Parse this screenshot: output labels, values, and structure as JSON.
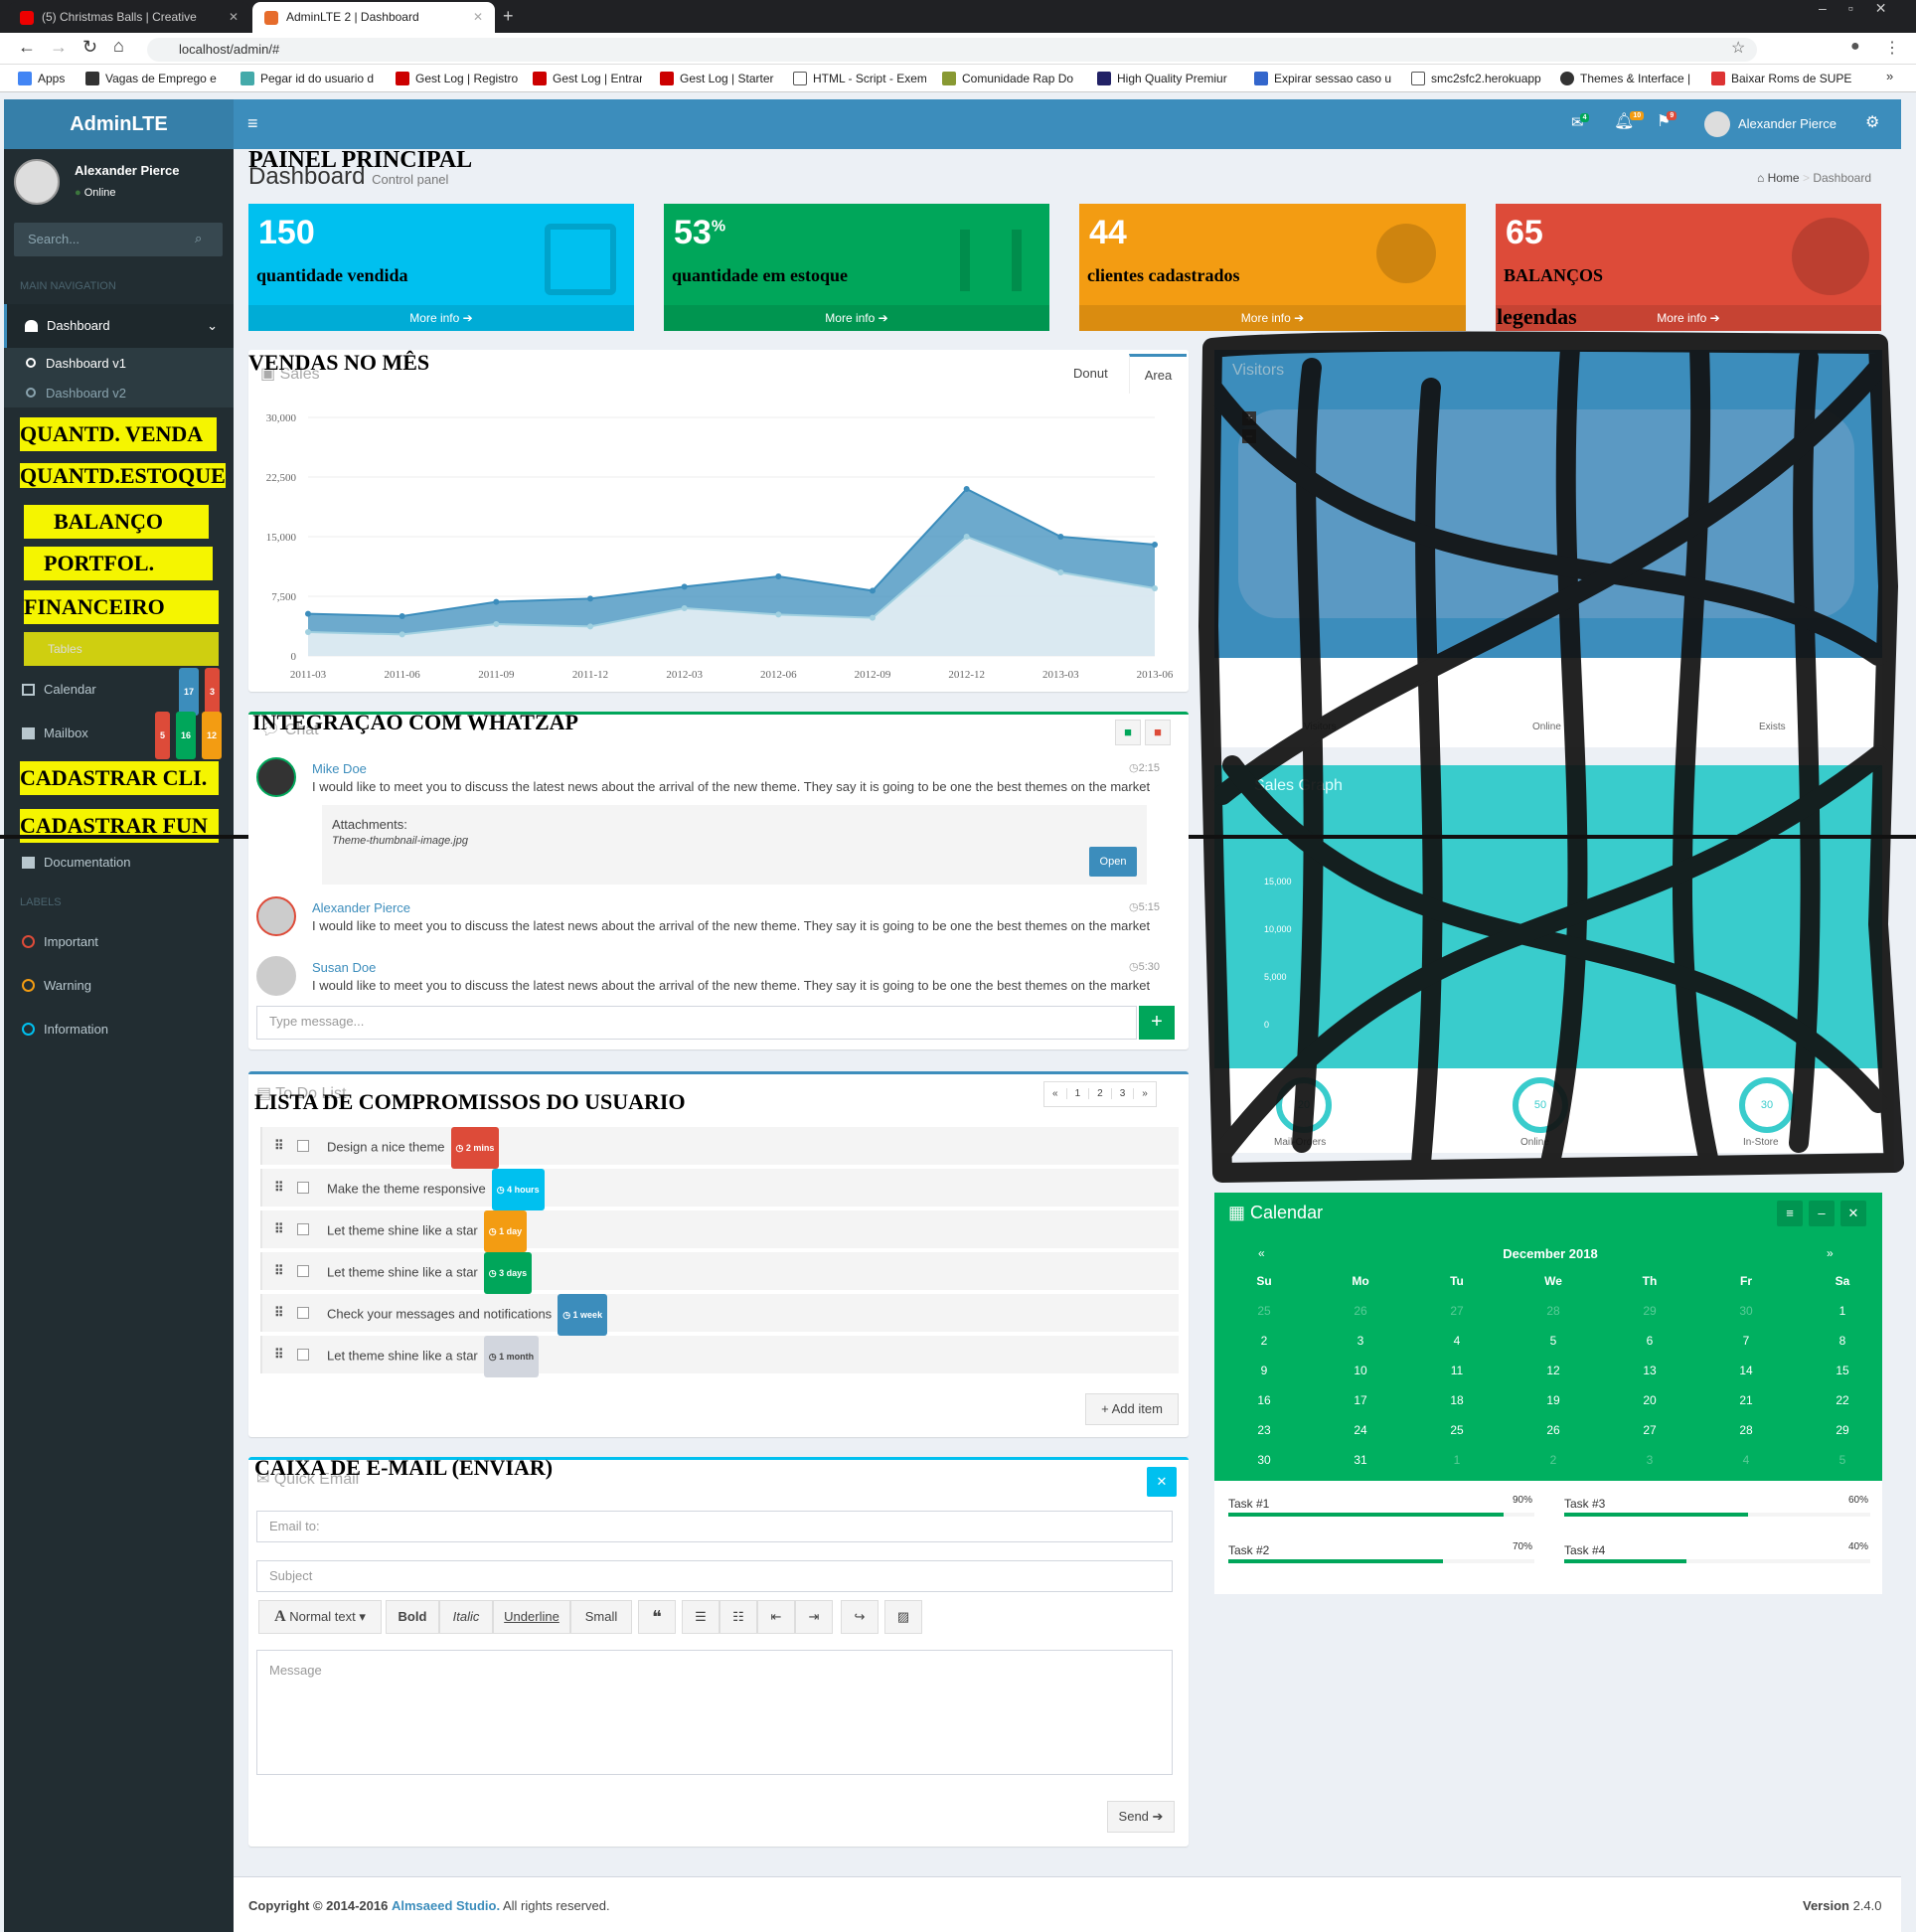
{
  "browser": {
    "tabs": [
      {
        "title": "(5) Christmas Balls | Creative"
      },
      {
        "title": "AdminLTE 2 | Dashboard"
      }
    ],
    "url": "localhost/admin/#",
    "bookmarks": [
      "Apps",
      "Vagas de Emprego e",
      "Pegar id do usuario d",
      "Gest Log | Registro",
      "Gest Log | Entrar",
      "Gest Log | Starter",
      "HTML - Script - Exem",
      "Comunidade Rap Do",
      "High Quality Premiur",
      "Expirar sessao caso u",
      "smc2sfc2.herokuapp",
      "Themes & Interface |",
      "Baixar Roms de SUPE"
    ]
  },
  "app": {
    "logo": "AdminLTE",
    "user": "Alexander Pierce",
    "status": "Online",
    "search_placeholder": "Search..."
  },
  "navbar": {
    "notif_mail": "4",
    "notif_bell": "10",
    "notif_flag": "9"
  },
  "sidebar": {
    "main_nav": "MAIN NAVIGATION",
    "dashboard": "Dashboard",
    "dash_v1": "Dashboard v1",
    "dash_v2": "Dashboard v2",
    "tables": "Tables",
    "calendar": "Calendar",
    "cal_badges": [
      "17",
      "3"
    ],
    "mailbox": "Mailbox",
    "mail_badges": [
      "5",
      "16",
      "12"
    ],
    "documentation": "Documentation",
    "labels_header": "LABELS",
    "labels": [
      "Important",
      "Warning",
      "Information"
    ]
  },
  "annotations": {
    "painel": "PAINEL PRINCIPAL",
    "sidebar": [
      "QUANTD. VENDA",
      "QUANTD.ESTOQUE",
      "BALANÇO",
      "PORTFOL.",
      "FINANCEIRO",
      "CADASTRAR CLI.",
      "CADASTRAR FUN"
    ],
    "vendas": "VENDAS NO MÊS",
    "whatsapp": "INTEGRAÇAO COM WHATZAP",
    "todo": "LISTA DE COMPROMISSOS DO USUARIO",
    "email": "CAIXA DE E-MAIL (ENVIAR)",
    "legendas": "legendas",
    "stat_labels": [
      "quantidade vendida",
      "quantidade em estoque",
      "clientes cadastrados",
      "BALANÇOS"
    ]
  },
  "header": {
    "title": "Dashboard",
    "subtitle": "Control panel",
    "crumb_home": "Home",
    "crumb_current": "Dashboard"
  },
  "stats": [
    {
      "value": "150",
      "sup": "",
      "more": "More info",
      "color": "#00c0ef"
    },
    {
      "value": "53",
      "sup": "%",
      "more": "More info",
      "color": "#00a65a"
    },
    {
      "value": "44",
      "sup": "",
      "more": "More info",
      "color": "#f39c12"
    },
    {
      "value": "65",
      "sup": "",
      "more": "More info",
      "color": "#dd4b39"
    }
  ],
  "sales": {
    "title": "Sales",
    "tab_donut": "Donut",
    "tab_area": "Area"
  },
  "chart_data": {
    "type": "area",
    "x": [
      "2011-03",
      "2011-06",
      "2011-09",
      "2011-12",
      "2012-03",
      "2012-06",
      "2012-09",
      "2012-12",
      "2013-03",
      "2013-06"
    ],
    "yticks": [
      "30,000",
      "22,500",
      "15,000",
      "7,500",
      "0"
    ],
    "ylim": [
      0,
      30000
    ],
    "series": [
      {
        "values": [
          5300,
          5000,
          6800,
          7200,
          8700,
          10000,
          8200,
          21000,
          15000,
          14000
        ]
      },
      {
        "values": [
          3000,
          2700,
          4000,
          3700,
          6000,
          5200,
          4800,
          15000,
          10500,
          8500
        ]
      }
    ]
  },
  "visitors": {
    "title": "Visitors",
    "labels": [
      "Visitors",
      "Online",
      "Exists"
    ]
  },
  "salesgraph": {
    "title": "Sales Graph",
    "yticks": [
      "15,000",
      "10,000",
      "5,000",
      "0"
    ],
    "knobs": [
      "20",
      "50",
      "30"
    ],
    "knob_labels": [
      "Mail-Orders",
      "Online",
      "In-Store"
    ]
  },
  "chat": {
    "title": "Chat",
    "messages": [
      {
        "name": "Mike Doe",
        "time": "2:15",
        "text": "I would like to meet you to discuss the latest news about the arrival of the new theme. They say it is going to be one the best themes on the market"
      },
      {
        "name": "Alexander Pierce",
        "time": "5:15",
        "text": "I would like to meet you to discuss the latest news about the arrival of the new theme. They say it is going to be one the best themes on the market"
      },
      {
        "name": "Susan Doe",
        "time": "5:30",
        "text": "I would like to meet you to discuss the latest news about the arrival of the new theme. They say it is going to be one the best themes on the market"
      }
    ],
    "attach_label": "Attachments:",
    "attach_file": "Theme-thumbnail-image.jpg",
    "open": "Open",
    "placeholder": "Type message..."
  },
  "todo": {
    "title": "To Do List",
    "pages": [
      "«",
      "1",
      "2",
      "3",
      "»"
    ],
    "items": [
      {
        "text": "Design a nice theme",
        "badge": "2 mins",
        "color": "#dd4b39"
      },
      {
        "text": "Make the theme responsive",
        "badge": "4 hours",
        "color": "#00c0ef"
      },
      {
        "text": "Let theme shine like a star",
        "badge": "1 day",
        "color": "#f39c12"
      },
      {
        "text": "Let theme shine like a star",
        "badge": "3 days",
        "color": "#00a65a"
      },
      {
        "text": "Check your messages and notifications",
        "badge": "1 week",
        "color": "#3c8dbc"
      },
      {
        "text": "Let theme shine like a star",
        "badge": "1 month",
        "color": "#d2d6de"
      }
    ],
    "add": "Add item"
  },
  "email": {
    "title": "Quick Email",
    "to": "Email to:",
    "subject": "Subject",
    "message": "Message",
    "normal": "Normal text",
    "bold": "Bold",
    "italic": "Italic",
    "underline": "Underline",
    "small": "Small",
    "send": "Send"
  },
  "calendar": {
    "title": "Calendar",
    "month": "December 2018",
    "prev": "«",
    "next": "»",
    "days": [
      "Su",
      "Mo",
      "Tu",
      "We",
      "Th",
      "Fr",
      "Sa"
    ],
    "weeks": [
      [
        "25",
        "26",
        "27",
        "28",
        "29",
        "30",
        "1"
      ],
      [
        "2",
        "3",
        "4",
        "5",
        "6",
        "7",
        "8"
      ],
      [
        "9",
        "10",
        "11",
        "12",
        "13",
        "14",
        "15"
      ],
      [
        "16",
        "17",
        "18",
        "19",
        "20",
        "21",
        "22"
      ],
      [
        "23",
        "24",
        "25",
        "26",
        "27",
        "28",
        "29"
      ],
      [
        "30",
        "31",
        "1",
        "2",
        "3",
        "4",
        "5"
      ]
    ],
    "tasks": [
      {
        "name": "Task #1",
        "pct": "90%",
        "v": 90
      },
      {
        "name": "Task #3",
        "pct": "60%",
        "v": 60
      },
      {
        "name": "Task #2",
        "pct": "70%",
        "v": 70
      },
      {
        "name": "Task #4",
        "pct": "40%",
        "v": 40
      }
    ]
  },
  "footer": {
    "copyright": "Copyright © 2014-2016",
    "studio": "Almsaeed Studio.",
    "rights": "All rights reserved.",
    "version_label": "Version",
    "version": "2.4.0"
  }
}
